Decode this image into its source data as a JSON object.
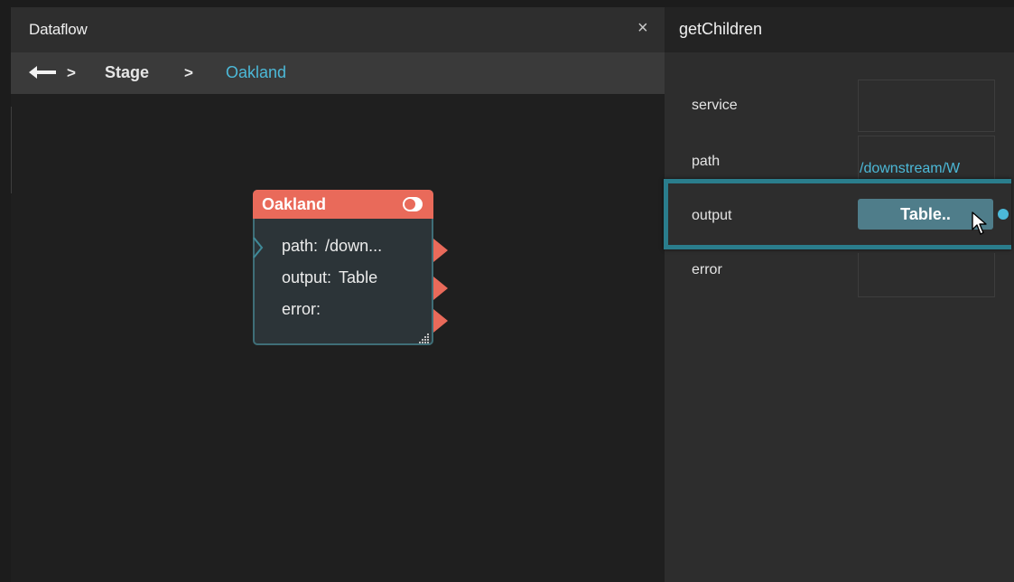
{
  "dataflow_panel": {
    "title": "Dataflow",
    "close_glyph": "×",
    "breadcrumb": {
      "separator": ">",
      "items": [
        "Stage",
        "Oakland"
      ]
    }
  },
  "node": {
    "title": "Oakland",
    "rows": [
      {
        "label": "path:",
        "value": "/down..."
      },
      {
        "label": "output:",
        "value": "Table"
      },
      {
        "label": "error:",
        "value": ""
      }
    ],
    "toggle_on": true
  },
  "properties_panel": {
    "title": "getChildren",
    "fields": [
      {
        "label": "service",
        "value": ""
      },
      {
        "label": "path",
        "value": "/downstream/W"
      },
      {
        "label": "output",
        "value": "Table.."
      },
      {
        "label": "error",
        "value": ""
      }
    ]
  },
  "colors": {
    "accent": "#4cb9d8",
    "node_header": "#e96a5a",
    "highlight": "#2a7d8c",
    "button": "#4f7d8a"
  },
  "icons": [
    "close-icon",
    "back-arrow-icon",
    "toggle-icon",
    "port-arrow-icon",
    "resize-grip-icon",
    "mouse-cursor-icon"
  ]
}
